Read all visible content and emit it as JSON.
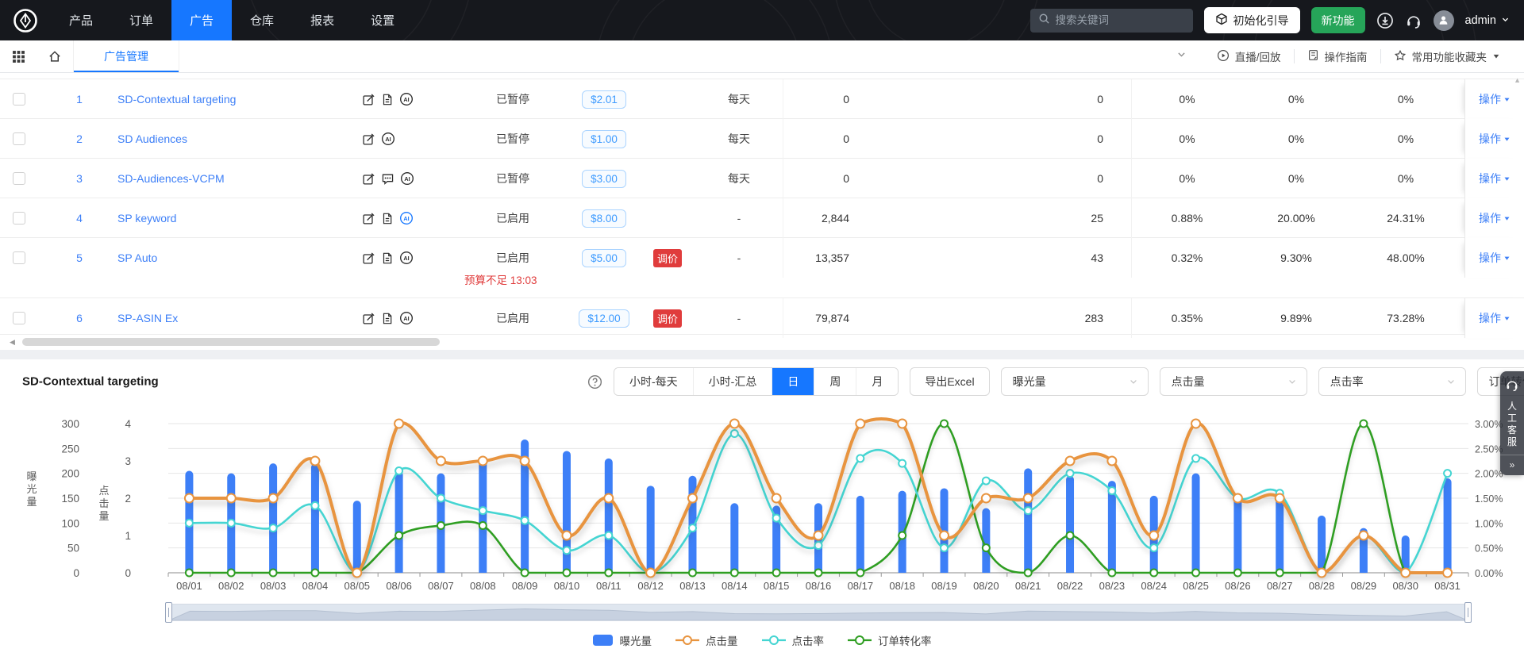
{
  "navbar": {
    "menu": [
      {
        "label": "产品",
        "active": false
      },
      {
        "label": "订单",
        "active": false
      },
      {
        "label": "广告",
        "active": true
      },
      {
        "label": "仓库",
        "active": false
      },
      {
        "label": "报表",
        "active": false
      },
      {
        "label": "设置",
        "active": false
      }
    ],
    "search_placeholder": "搜索关键词",
    "init_guide_label": "初始化引导",
    "new_feature_label": "新功能",
    "username": "admin"
  },
  "tabbar": {
    "active_tab": "广告管理",
    "live_label": "直播/回放",
    "guide_label": "操作指南",
    "favorites_label": "常用功能收藏夹"
  },
  "table": {
    "action_label": "操作",
    "rows": [
      {
        "num": "1",
        "name": "SD-Contextual targeting",
        "icons": [
          "edit",
          "doc",
          "ai"
        ],
        "status": "已暂停",
        "price": "$2.01",
        "reprice": "",
        "budget": "每天",
        "impressions": "0",
        "clicks": "0",
        "ctr": "0%",
        "rate2": "0%",
        "rate3": "0%",
        "warning": ""
      },
      {
        "num": "2",
        "name": "SD Audiences",
        "icons": [
          "edit",
          "ai"
        ],
        "status": "已暂停",
        "price": "$1.00",
        "reprice": "",
        "budget": "每天",
        "impressions": "0",
        "clicks": "0",
        "ctr": "0%",
        "rate2": "0%",
        "rate3": "0%",
        "warning": ""
      },
      {
        "num": "3",
        "name": "SD-Audiences-VCPM",
        "icons": [
          "edit",
          "msg",
          "ai"
        ],
        "status": "已暂停",
        "price": "$3.00",
        "reprice": "",
        "budget": "每天",
        "impressions": "0",
        "clicks": "0",
        "ctr": "0%",
        "rate2": "0%",
        "rate3": "0%",
        "warning": ""
      },
      {
        "num": "4",
        "name": "SP keyword",
        "icons": [
          "edit",
          "doc",
          "ai-blue"
        ],
        "status": "已启用",
        "price": "$8.00",
        "reprice": "",
        "budget": "-",
        "impressions": "2,844",
        "clicks": "25",
        "ctr": "0.88%",
        "rate2": "20.00%",
        "rate3": "24.31%",
        "warning": ""
      },
      {
        "num": "5",
        "name": "SP Auto",
        "icons": [
          "edit",
          "doc",
          "ai"
        ],
        "status": "已启用",
        "price": "$5.00",
        "reprice": "调价",
        "budget": "-",
        "impressions": "13,357",
        "clicks": "43",
        "ctr": "0.32%",
        "rate2": "9.30%",
        "rate3": "48.00%",
        "warning": "预算不足 13:03"
      },
      {
        "num": "6",
        "name": "SP-ASIN Ex",
        "icons": [
          "edit",
          "doc",
          "ai"
        ],
        "status": "已启用",
        "price": "$12.00",
        "reprice": "调价",
        "budget": "-",
        "impressions": "79,874",
        "clicks": "283",
        "ctr": "0.35%",
        "rate2": "9.89%",
        "rate3": "73.28%",
        "warning": ""
      }
    ]
  },
  "chart_header": {
    "title": "SD-Contextual targeting",
    "range_buttons": [
      {
        "label": "小时-每天",
        "active": false
      },
      {
        "label": "小时-汇总",
        "active": false
      },
      {
        "label": "日",
        "active": true
      },
      {
        "label": "周",
        "active": false
      },
      {
        "label": "月",
        "active": false
      }
    ],
    "export_label": "导出Excel",
    "metric_selects": [
      "曝光量",
      "点击量",
      "点击率",
      "订单转化率"
    ]
  },
  "chart_data": {
    "type": "bar+line",
    "categories": [
      "08/01",
      "08/02",
      "08/03",
      "08/04",
      "08/05",
      "08/06",
      "08/07",
      "08/08",
      "08/09",
      "08/10",
      "08/11",
      "08/12",
      "08/13",
      "08/14",
      "08/15",
      "08/16",
      "08/17",
      "08/18",
      "08/19",
      "08/20",
      "08/21",
      "08/22",
      "08/23",
      "08/24",
      "08/25",
      "08/26",
      "08/27",
      "08/28",
      "08/29",
      "08/30",
      "08/31"
    ],
    "series": [
      {
        "name": "曝光量",
        "type": "bar",
        "y_axis": "impressions",
        "color": "#3d7ff7",
        "values": [
          205,
          200,
          220,
          220,
          145,
          205,
          200,
          235,
          268,
          245,
          230,
          175,
          195,
          140,
          135,
          140,
          155,
          165,
          170,
          130,
          210,
          195,
          185,
          155,
          200,
          160,
          150,
          115,
          90,
          75,
          190
        ]
      },
      {
        "name": "点击量",
        "type": "line",
        "y_axis": "clicks",
        "color": "#e8943f",
        "values": [
          2,
          2,
          2,
          3,
          0,
          4,
          3,
          3,
          3,
          1,
          2,
          0,
          2,
          4,
          2,
          1,
          4,
          4,
          1,
          2,
          2,
          3,
          3,
          1,
          4,
          2,
          2,
          0,
          1,
          0,
          0
        ]
      },
      {
        "name": "点击率",
        "type": "line",
        "y_axis": "percent",
        "color": "#45d5d2",
        "values": [
          1.0,
          1.0,
          0.9,
          1.35,
          0,
          2.05,
          1.5,
          1.25,
          1.05,
          0.45,
          0.75,
          0,
          0.9,
          2.8,
          1.1,
          0.55,
          2.3,
          2.2,
          0.5,
          1.85,
          1.25,
          2.0,
          1.65,
          0.5,
          2.3,
          1.5,
          1.6,
          0,
          0.75,
          0,
          2.0
        ]
      },
      {
        "name": "订单转化率",
        "type": "line",
        "y_axis": "percent",
        "color": "#2f9e22",
        "values": [
          0,
          0,
          0,
          0,
          0,
          0.75,
          0.95,
          0.95,
          0,
          0,
          0,
          0,
          0,
          0,
          0,
          0,
          0,
          0.75,
          3.0,
          0.5,
          0,
          0.75,
          0,
          0,
          0,
          0,
          0,
          0,
          3.0,
          0,
          0
        ]
      }
    ],
    "axes": {
      "impressions": {
        "title": "曝光量",
        "ticks": [
          300,
          250,
          200,
          150,
          100,
          50,
          0
        ],
        "max": 300
      },
      "clicks": {
        "title": "点击量",
        "ticks": [
          4,
          3,
          2,
          1,
          0
        ],
        "max": 4
      },
      "percent": {
        "ticks": [
          "3.00%",
          "2.50%",
          "2.00%",
          "1.50%",
          "1.00%",
          "0.50%",
          "0.00%"
        ],
        "max": 3
      }
    },
    "legend": [
      "曝光量",
      "点击量",
      "点击率",
      "订单转化率"
    ],
    "grid": true,
    "legend_position": "bottom"
  },
  "service_widget": {
    "label": "人工客服",
    "expand_symbol": "»"
  }
}
